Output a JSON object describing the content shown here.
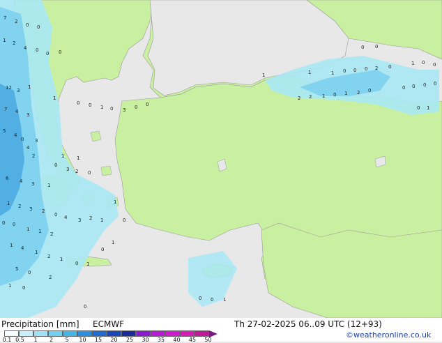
{
  "map": {
    "colors": {
      "sea": "#e8e8e8",
      "land": "#c8f0a0",
      "border": "#9a9a9a",
      "light_precip": "#a8e8f4",
      "moderate_precip": "#7dd0ee",
      "heavy_precip": "#4aa8e0"
    },
    "values": [
      "7",
      "2",
      "0",
      "0",
      "1",
      "2",
      "4",
      "0",
      "0",
      "0",
      "12",
      "3",
      "1",
      "1",
      "0",
      "0",
      "1",
      "0",
      "3",
      "0",
      "0",
      "7",
      "4",
      "3",
      "5",
      "4",
      "0",
      "3",
      "4",
      "2",
      "1",
      "1",
      "6",
      "4",
      "3",
      "1",
      "0",
      "3",
      "2",
      "0",
      "1",
      "2",
      "3",
      "2",
      "0",
      "4",
      "3",
      "2",
      "1",
      "1",
      "0",
      "0",
      "0",
      "1",
      "1",
      "2",
      "1",
      "4",
      "1",
      "2",
      "1",
      "5",
      "0",
      "0",
      "1",
      "2",
      "1",
      "0",
      "0",
      "1",
      "0",
      "0",
      "0",
      "1",
      "1",
      "1",
      "1",
      "0",
      "0",
      "0",
      "2",
      "0",
      "2",
      "2",
      "1",
      "0",
      "1",
      "2",
      "0",
      "1",
      "0",
      "0",
      "0",
      "0",
      "0",
      "0",
      "0",
      "1",
      "0",
      "0"
    ]
  },
  "footer": {
    "title": "Precipitation [mm]",
    "model": "ECMWF",
    "valid_time": "Th 27-02-2025 06..09 UTC (12+93)",
    "credit": "©weatheronline.co.uk",
    "legend_ticks": [
      "0.1",
      "0.5",
      "1",
      "2",
      "5",
      "10",
      "15",
      "20",
      "25",
      "30",
      "35",
      "40",
      "45",
      "50"
    ],
    "legend_colors": [
      "#f5fcfd",
      "#c9f0fa",
      "#9fe2f5",
      "#6fd0ef",
      "#41b6e8",
      "#2b8fe0",
      "#1e6bd2",
      "#1a47b8",
      "#1a2a9a",
      "#8a1ad0",
      "#b81ad8",
      "#d01ad0",
      "#d81ab8",
      "#c01a9a"
    ]
  }
}
